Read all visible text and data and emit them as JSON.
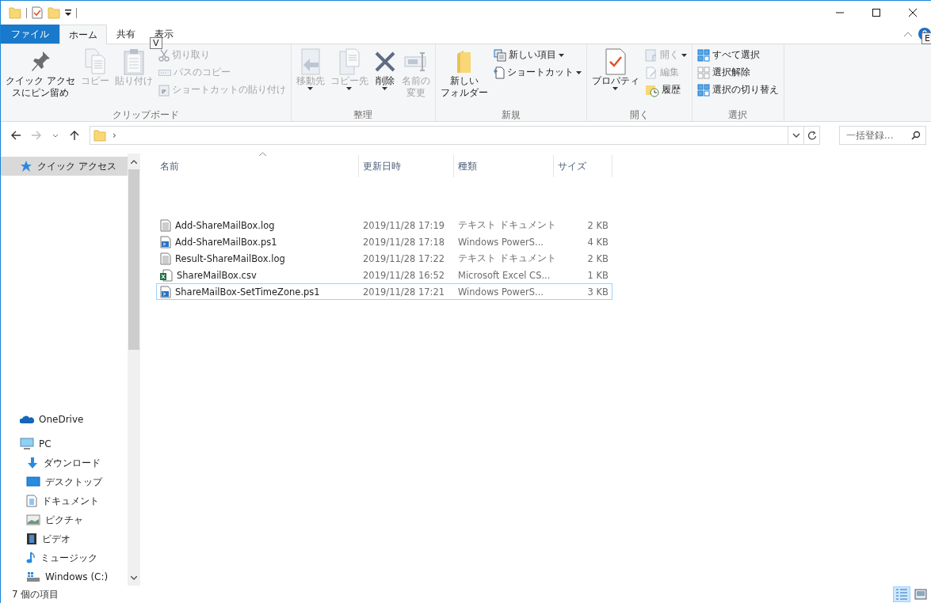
{
  "ribbon": {
    "tabs": [
      {
        "label": "ファイル",
        "kind": "file",
        "selected": false
      },
      {
        "label": "ホーム",
        "kind": "tab",
        "selected": true
      },
      {
        "label": "共有",
        "kind": "tab",
        "selected": false
      },
      {
        "label": "表示",
        "kind": "tab",
        "selected": false,
        "keytip": "V"
      }
    ],
    "help_keytip": "E",
    "groups": [
      {
        "label": "クリップボード",
        "buttons": [
          {
            "label": "クイック アクセスにピン留め",
            "kind": "large",
            "disabled": false
          },
          {
            "label": "コピー",
            "kind": "large",
            "disabled": true
          },
          {
            "label": "貼り付け",
            "kind": "large",
            "disabled": true
          },
          {
            "label": "切り取り",
            "kind": "small",
            "disabled": true
          },
          {
            "label": "パスのコピー",
            "kind": "small",
            "disabled": true
          },
          {
            "label": "ショートカットの貼り付け",
            "kind": "small",
            "disabled": true
          }
        ]
      },
      {
        "label": "整理",
        "buttons": [
          {
            "label": "移動先",
            "kind": "large",
            "disabled": true,
            "caret": true
          },
          {
            "label": "コピー先",
            "kind": "large",
            "disabled": true,
            "caret": true
          },
          {
            "label": "削除",
            "kind": "large",
            "disabled": false,
            "caret": true
          },
          {
            "label": "名前の変更",
            "kind": "large",
            "disabled": true
          }
        ]
      },
      {
        "label": "新規",
        "buttons": [
          {
            "label": "新しいフォルダー",
            "kind": "large",
            "disabled": false
          },
          {
            "label": "新しい項目",
            "kind": "small",
            "disabled": false,
            "caret": true
          },
          {
            "label": "ショートカット",
            "kind": "small",
            "disabled": false,
            "caret": true
          }
        ]
      },
      {
        "label": "開く",
        "buttons": [
          {
            "label": "プロパティ",
            "kind": "large",
            "disabled": false,
            "caret": true
          },
          {
            "label": "開く",
            "kind": "small",
            "disabled": true,
            "caret": true
          },
          {
            "label": "編集",
            "kind": "small",
            "disabled": true
          },
          {
            "label": "履歴",
            "kind": "small",
            "disabled": false
          }
        ]
      },
      {
        "label": "選択",
        "buttons": [
          {
            "label": "すべて選択",
            "kind": "small",
            "disabled": false
          },
          {
            "label": "選択解除",
            "kind": "small",
            "disabled": false
          },
          {
            "label": "選択の切り替え",
            "kind": "small",
            "disabled": false
          }
        ]
      }
    ]
  },
  "address_bar": {
    "path_separator": "›",
    "search": {
      "placeholder": "一括登録..."
    }
  },
  "sidebar": {
    "items": [
      {
        "label": "クイック アクセス",
        "selected": true
      },
      {
        "label": "OneDrive",
        "selected": false
      },
      {
        "label": "PC",
        "selected": false,
        "children": [
          {
            "label": "ダウンロード",
            "selected": false
          },
          {
            "label": "デスクトップ",
            "selected": false
          },
          {
            "label": "ドキュメント",
            "selected": false
          },
          {
            "label": "ピクチャ",
            "selected": false
          },
          {
            "label": "ビデオ",
            "selected": false
          },
          {
            "label": "ミュージック",
            "selected": false
          },
          {
            "label": "Windows (C:)",
            "selected": false
          }
        ]
      }
    ]
  },
  "table": {
    "columns": [
      "名前",
      "更新日時",
      "種類",
      "サイズ"
    ],
    "rows": [
      {
        "kind": "text",
        "name": "Add-ShareMailBox.log",
        "modified": "2019/11/28 17:19",
        "type": "テキスト ドキュメント",
        "size": "2 KB",
        "focused": false
      },
      {
        "kind": "script",
        "name": "Add-ShareMailBox.ps1",
        "modified": "2019/11/28 17:18",
        "type": "Windows PowerS...",
        "size": "4 KB",
        "focused": false
      },
      {
        "kind": "text",
        "name": "Result-ShareMailBox.log",
        "modified": "2019/11/28 17:22",
        "type": "テキスト ドキュメント",
        "size": "2 KB",
        "focused": false
      },
      {
        "kind": "spreadsheet",
        "name": "ShareMailBox.csv",
        "modified": "2019/11/28 16:52",
        "type": "Microsoft Excel CS...",
        "size": "1 KB",
        "focused": false
      },
      {
        "kind": "script",
        "name": "ShareMailBox-SetTimeZone.ps1",
        "modified": "2019/11/28 17:21",
        "type": "Windows PowerS...",
        "size": "3 KB",
        "focused": true
      }
    ]
  },
  "status_bar": {
    "item_count": "7 個の項目",
    "views": [
      {
        "kind": "details",
        "selected": true
      },
      {
        "kind": "large-icons",
        "selected": false
      }
    ]
  }
}
